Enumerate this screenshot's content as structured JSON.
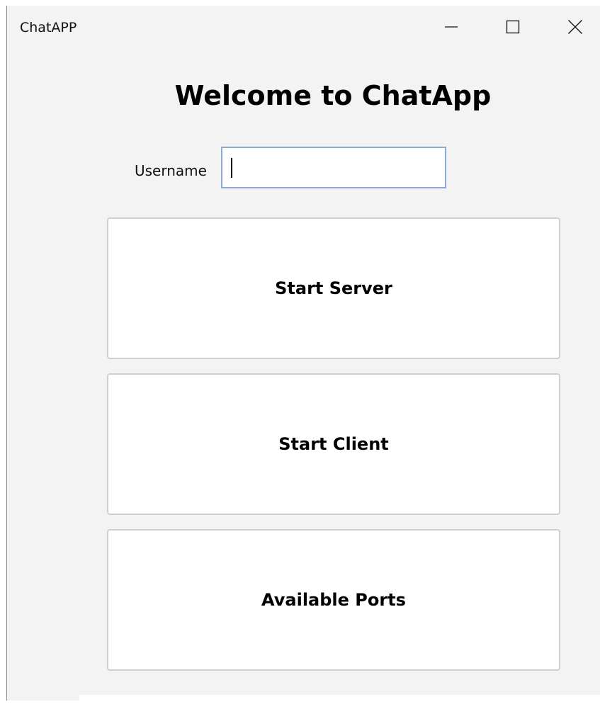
{
  "window": {
    "title": "ChatAPP",
    "controls": {
      "minimize_icon": "minimize-icon",
      "maximize_icon": "maximize-icon",
      "close_icon": "close-icon"
    }
  },
  "main": {
    "heading": "Welcome to ChatApp",
    "username": {
      "label": "Username",
      "value": "",
      "focused": true
    },
    "buttons": {
      "start_server": "Start Server",
      "start_client": "Start Client",
      "available_ports": "Available Ports"
    }
  },
  "colors": {
    "window_bg": "#f3f3f3",
    "input_focus_border": "#89a9d6",
    "button_bg": "#ffffff",
    "button_border": "#cfcfcf"
  }
}
